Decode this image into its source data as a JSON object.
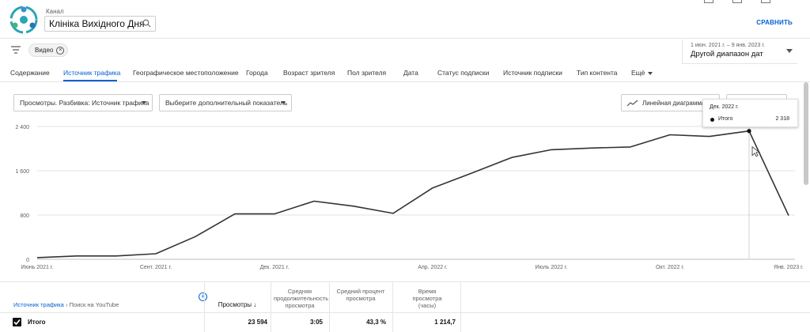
{
  "header": {
    "channel_label": "Канал",
    "channel_name": "Клініка Вихідного Дня",
    "compare_label": "СРАВНИТЬ"
  },
  "filters": {
    "chip_label": "Видео",
    "date_range": "1 июн. 2021 г. – 9 янв. 2023 г.",
    "date_mode": "Другой диапазон дат"
  },
  "tabs": [
    {
      "label": "Содержание"
    },
    {
      "label": "Источник трафика"
    },
    {
      "label": "Географическое местоположение"
    },
    {
      "label": "Города"
    },
    {
      "label": "Возраст зрителя"
    },
    {
      "label": "Пол зрителя"
    },
    {
      "label": "Дата"
    },
    {
      "label": "Статус подписки"
    },
    {
      "label": "Источник подписки"
    },
    {
      "label": "Тип контента"
    },
    {
      "label": "Ещё"
    }
  ],
  "controls": {
    "metric_dropdown": "Просмотры. Разбивка: Источник трафика",
    "extra_metric_dropdown": "Выберите дополнительный показатель",
    "chart_type": "Линейная диаграмма"
  },
  "tooltip": {
    "date": "Дек. 2022 г.",
    "series": "Итого",
    "value": "2 318"
  },
  "chart_data": {
    "type": "line",
    "title": "",
    "x_tick_labels": [
      "Июнь 2021 г.",
      "Сент. 2021 г.",
      "Дек. 2021 г.",
      "Апр. 2022 г.",
      "Июль 2022 г.",
      "Окт. 2022 г.",
      "Янв. 2023 г."
    ],
    "y_tick_labels": [
      "0",
      "800",
      "1 600",
      "2 400"
    ],
    "ylim": [
      0,
      2400
    ],
    "grid": true,
    "series": [
      {
        "name": "Итого",
        "x": [
          "2021-06",
          "2021-07",
          "2021-08",
          "2021-09",
          "2021-10",
          "2021-11",
          "2021-12",
          "2022-01",
          "2022-02",
          "2022-03",
          "2022-04",
          "2022-05",
          "2022-06",
          "2022-07",
          "2022-08",
          "2022-09",
          "2022-10",
          "2022-11",
          "2022-12",
          "2023-01"
        ],
        "values": [
          30,
          60,
          60,
          100,
          410,
          820,
          820,
          1050,
          960,
          830,
          1290,
          1560,
          1840,
          1980,
          2010,
          2030,
          2250,
          2220,
          2318,
          790
        ]
      }
    ]
  },
  "table": {
    "breadcrumb_link": "Источник трафика",
    "breadcrumb_rest": "› Поиск на YouTube",
    "headers": [
      "Просмотры ↓",
      "Средняя продолжительность просмотра",
      "Средний процент просмотра",
      "Время просмотра (часы)"
    ],
    "total_label": "Итого",
    "total_values": [
      "23 594",
      "3:05",
      "43,3 %",
      "1 214,7"
    ]
  },
  "colors": {
    "accent": "#065fd4",
    "line": "#333333"
  }
}
